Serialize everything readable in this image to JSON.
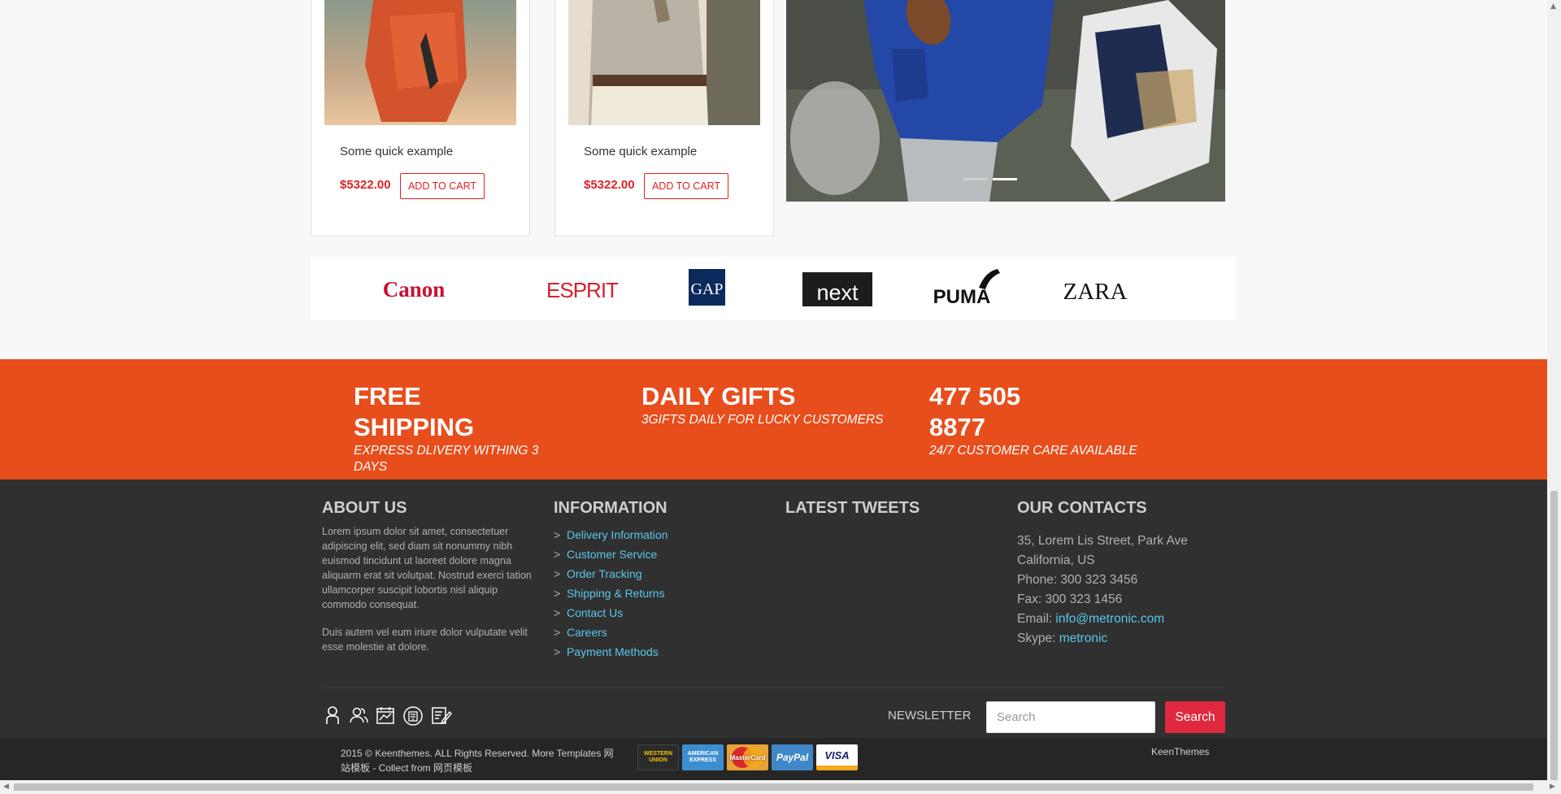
{
  "products": [
    {
      "title": "Some quick example",
      "price": "$5322.00",
      "button": "ADD TO CART"
    },
    {
      "title": "Some quick example",
      "price": "$5322.00",
      "button": "ADD TO CART"
    }
  ],
  "brands": [
    "Canon",
    "ESPRIT",
    "GAP",
    "next",
    "PUMA",
    "ZARA"
  ],
  "promo": [
    {
      "title": "FREE SHIPPING",
      "subtitle": "EXPRESS DLIVERY WITHING 3 DAYS"
    },
    {
      "title": "DAILY GIFTS",
      "subtitle": "3GIFTS DAILY FOR LUCKY CUSTOMERS"
    },
    {
      "title": "477 505 8877",
      "subtitle": "24/7 CUSTOMER CARE AVAILABLE"
    }
  ],
  "footer": {
    "about": {
      "heading": "ABOUT US",
      "p1": "Lorem ipsum dolor sit amet, consectetuer adipiscing elit, sed diam sit nonummy nibh euismod tincidunt ut laoreet dolore magna aliquarm erat sit volutpat. Nostrud exerci tation ullamcorper suscipit lobortis nisl aliquip commodo consequat.",
      "p2": "Duis autem vel eum iriure dolor vulputate velit esse molestie at dolore."
    },
    "information": {
      "heading": "INFORMATION",
      "links": [
        "Delivery Information",
        "Customer Service",
        "Order Tracking",
        "Shipping & Returns",
        "Contact Us",
        "Careers",
        "Payment Methods"
      ]
    },
    "tweets": {
      "heading": "LATEST TWEETS"
    },
    "contacts": {
      "heading": "OUR CONTACTS",
      "address1": "35, Lorem Lis Street, Park Ave",
      "address2": "California, US",
      "phone": "Phone: 300 323 3456",
      "fax": "Fax: 300 323 1456",
      "email_label": "Email: ",
      "email": "info@metronic.com",
      "skype_label": "Skype: ",
      "skype": "metronic"
    },
    "newsletter": {
      "label": "NEWSLETTER",
      "placeholder": "Search",
      "button": "Search"
    },
    "social_icons": [
      "user-icon",
      "users-icon",
      "chart-icon",
      "exam-icon",
      "edit-icon"
    ]
  },
  "bottom": {
    "copyright": "2015 © Keenthemes. ALL Rights Reserved. More Templates 网站模板 - Collect from 网页模板",
    "payments": [
      "WESTERN UNION",
      "AMERICAN EXPRESS",
      "MasterCard",
      "PayPal",
      "VISA"
    ],
    "brand": "KeenThemes"
  },
  "colors": {
    "accent": "#e84d1c",
    "price": "#e02222",
    "link": "#57c8eb",
    "footer_bg": "#313030",
    "search_btn": "#e0293f"
  }
}
